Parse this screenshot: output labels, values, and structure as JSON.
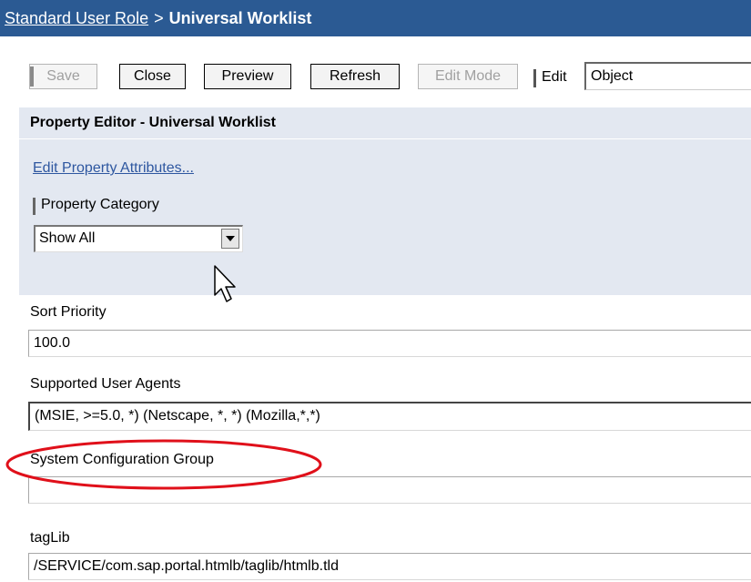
{
  "breadcrumb": {
    "parent_label": "Standard User Role",
    "separator": ">",
    "current_label": "Universal Worklist"
  },
  "toolbar": {
    "save_label": "Save",
    "close_label": "Close",
    "preview_label": "Preview",
    "refresh_label": "Refresh",
    "edit_mode_label": "Edit Mode",
    "edit_label": "Edit",
    "edit_value": "Object"
  },
  "property_editor": {
    "title": "Property Editor - Universal Worklist",
    "edit_attributes_link": "Edit Property Attributes...",
    "category_label": "Property Category",
    "category_value": "Show All"
  },
  "fields": [
    {
      "label": "Sort Priority",
      "value": "100.0"
    },
    {
      "label": "Supported User Agents",
      "value": "(MSIE, >=5.0, *) (Netscape, *, *) (Mozilla,*,*)"
    },
    {
      "label": "System Configuration Group",
      "value": ""
    },
    {
      "label": "tagLib",
      "value": "/SERVICE/com.sap.portal.htmlb/taglib/htmlb.tld"
    }
  ],
  "colors": {
    "title_bar": "#2b5a93",
    "panel_background": "#e3e8f1",
    "link": "#2e57a0",
    "highlight_ellipse": "#e0101a"
  }
}
